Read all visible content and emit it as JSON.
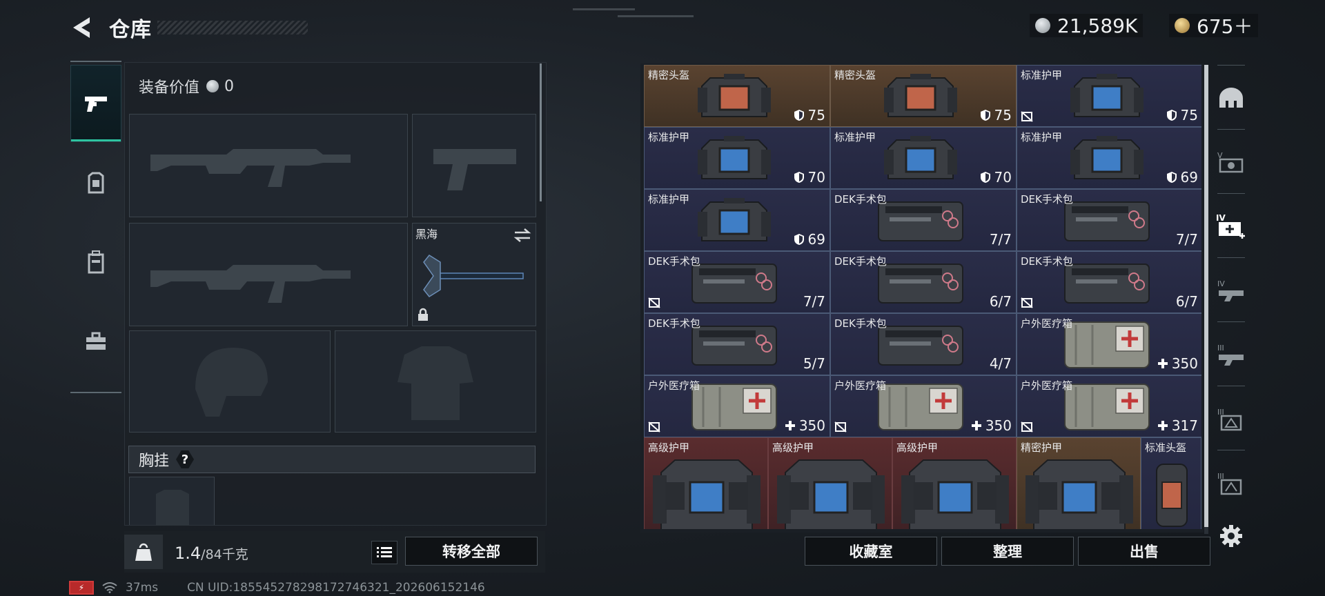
{
  "header": {
    "title": "仓库"
  },
  "currency": [
    {
      "name": "coin-silver",
      "value": "21,589K",
      "color": "#bfc4c8"
    },
    {
      "name": "coin-gold",
      "value": "675＋",
      "color": "#d8b46a"
    }
  ],
  "nav": {
    "items": [
      {
        "id": "weapons",
        "icon": "pistol-icon",
        "active": true
      },
      {
        "id": "helmet",
        "icon": "armor-icon",
        "active": false
      },
      {
        "id": "bag",
        "icon": "backpack-icon",
        "active": false
      },
      {
        "id": "case",
        "icon": "toolbox-icon",
        "active": false
      }
    ]
  },
  "equipment": {
    "value_label": "装备价值",
    "value": "0",
    "melee_name": "黑海",
    "section_label": "胸挂",
    "section_help": "?"
  },
  "footer_left": {
    "weight": "1.4",
    "capacity": "/84千克",
    "transfer_all": "转移全部"
  },
  "grid": {
    "items": [
      {
        "name": "精密头盔",
        "value": "75",
        "icon": "shield",
        "rarity": "gold",
        "art": "helmet"
      },
      {
        "name": "精密头盔",
        "value": "75",
        "icon": "shield",
        "rarity": "gold",
        "art": "helmet"
      },
      {
        "name": "标准护甲",
        "value": "75",
        "icon": "shield",
        "rarity": "purple",
        "art": "vest",
        "noflag": true
      },
      {
        "name": "标准护甲",
        "value": "70",
        "icon": "shield",
        "rarity": "purple",
        "art": "vest"
      },
      {
        "name": "标准护甲",
        "value": "70",
        "icon": "shield",
        "rarity": "purple",
        "art": "vest"
      },
      {
        "name": "标准护甲",
        "value": "69",
        "icon": "shield",
        "rarity": "purple",
        "art": "vest"
      },
      {
        "name": "标准护甲",
        "value": "69",
        "icon": "shield",
        "rarity": "purple",
        "art": "vest"
      },
      {
        "name": "DEK手术包",
        "value": "7/7",
        "icon": "",
        "rarity": "purple",
        "art": "kit"
      },
      {
        "name": "DEK手术包",
        "value": "7/7",
        "icon": "",
        "rarity": "purple",
        "art": "kit"
      },
      {
        "name": "DEK手术包",
        "value": "7/7",
        "icon": "",
        "rarity": "purple",
        "art": "kit",
        "noflag": true
      },
      {
        "name": "DEK手术包",
        "value": "6/7",
        "icon": "",
        "rarity": "purple",
        "art": "kit"
      },
      {
        "name": "DEK手术包",
        "value": "6/7",
        "icon": "",
        "rarity": "purple",
        "art": "kit",
        "noflag": true
      },
      {
        "name": "DEK手术包",
        "value": "5/7",
        "icon": "",
        "rarity": "purple",
        "art": "kit"
      },
      {
        "name": "DEK手术包",
        "value": "4/7",
        "icon": "",
        "rarity": "purple",
        "art": "kit"
      },
      {
        "name": "户外医疗箱",
        "value": "350",
        "icon": "plus",
        "rarity": "purple",
        "art": "med"
      },
      {
        "name": "户外医疗箱",
        "value": "350",
        "icon": "plus",
        "rarity": "purple",
        "art": "med",
        "noflag": true
      },
      {
        "name": "户外医疗箱",
        "value": "350",
        "icon": "plus",
        "rarity": "purple",
        "art": "med",
        "noflag": true
      },
      {
        "name": "户外医疗箱",
        "value": "317",
        "icon": "plus",
        "rarity": "purple",
        "art": "med",
        "noflag": true
      },
      {
        "name": "高级护甲",
        "value": "",
        "icon": "",
        "rarity": "red",
        "art": "bigvest"
      },
      {
        "name": "高级护甲",
        "value": "",
        "icon": "",
        "rarity": "red",
        "art": "bigvest"
      },
      {
        "name": "高级护甲",
        "value": "",
        "icon": "",
        "rarity": "red",
        "art": "bigvest"
      },
      {
        "name": "精密护甲",
        "value": "",
        "icon": "",
        "rarity": "gold",
        "art": "bigvest"
      },
      {
        "name": "标准头盔",
        "value": "",
        "icon": "",
        "rarity": "purple",
        "art": "helm2"
      }
    ]
  },
  "footer_right": {
    "collection": "收藏室",
    "sort": "整理",
    "sell": "出售"
  },
  "rightbar": {
    "filters": [
      "helmet-filter-icon",
      "tier-v-filter-icon",
      "tier-iv-med-filter-icon",
      "tier-iv-filter-icon",
      "tier-iii-filter-icon",
      "tier-iii-armor-filter-icon",
      "tier-iii-vest-filter-icon",
      "settings-icon"
    ]
  },
  "status": {
    "ping": "37ms",
    "uid": "CN UID:18554527829817274632​1_202606152146"
  }
}
